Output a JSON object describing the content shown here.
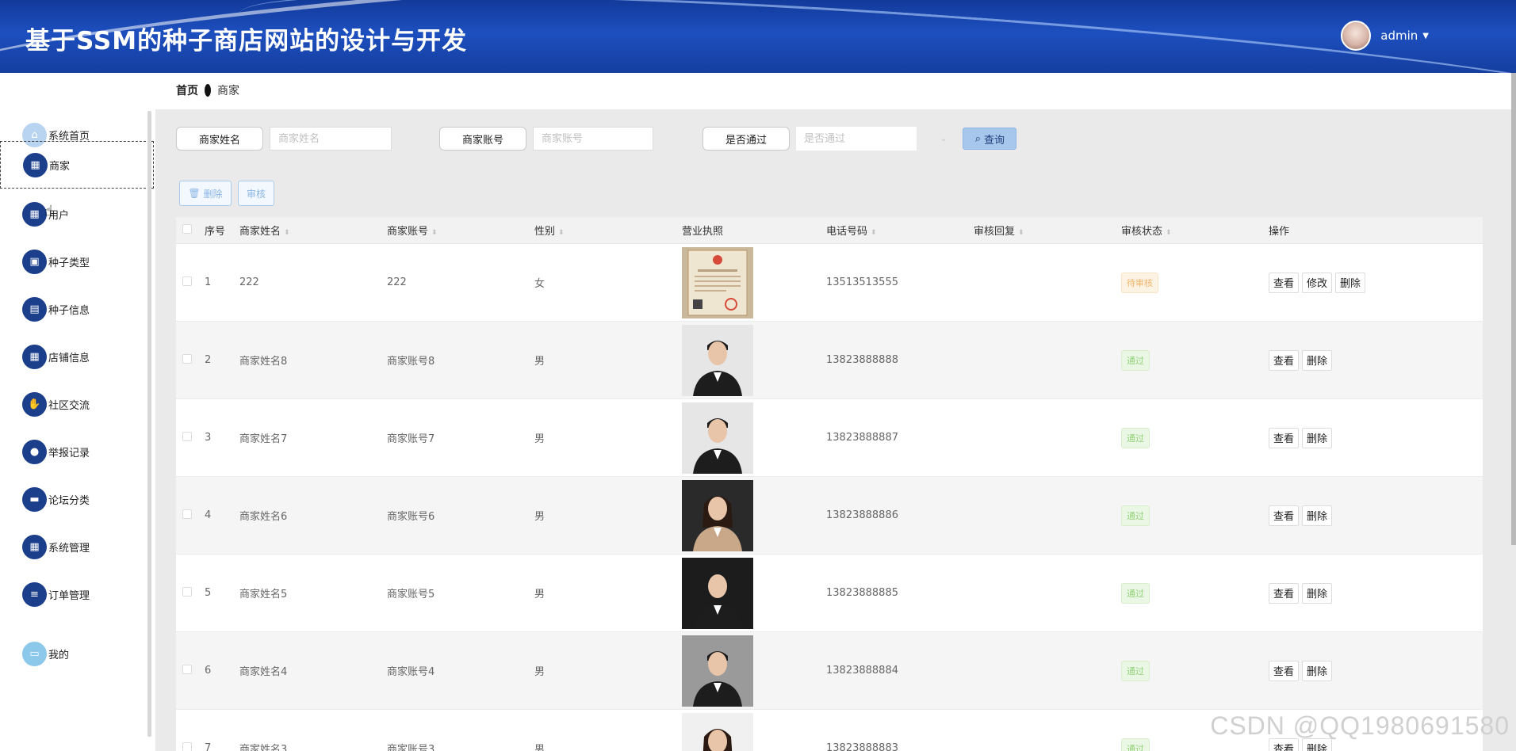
{
  "header": {
    "title": "基于SSM的种子商店网站的设计与开发",
    "username": "admin"
  },
  "breadcrumb": {
    "home": "首页",
    "current": "商家"
  },
  "sidebar": {
    "items": [
      {
        "label": "系统首页",
        "icon": "home-icon"
      },
      {
        "label": "商家",
        "icon": "grid-icon"
      },
      {
        "label": "用户",
        "icon": "grid-icon"
      },
      {
        "label": "种子类型",
        "icon": "briefcase-icon"
      },
      {
        "label": "种子信息",
        "icon": "clipboard-icon"
      },
      {
        "label": "店铺信息",
        "icon": "grid-icon"
      },
      {
        "label": "社区交流",
        "icon": "thumbs-up-icon"
      },
      {
        "label": "举报记录",
        "icon": "bulb-icon"
      },
      {
        "label": "论坛分类",
        "icon": "ticket-icon"
      },
      {
        "label": "系统管理",
        "icon": "grid-icon"
      },
      {
        "label": "订单管理",
        "icon": "list-icon"
      },
      {
        "label": "我的",
        "icon": "card-icon"
      }
    ]
  },
  "search": {
    "name_label": "商家姓名",
    "name_placeholder": "商家姓名",
    "account_label": "商家账号",
    "account_placeholder": "商家账号",
    "pass_label": "是否通过",
    "pass_placeholder": "是否通过",
    "query_label": "查询"
  },
  "actions": {
    "delete_label": "删除",
    "audit_label": "审核"
  },
  "table": {
    "headers": {
      "no": "序号",
      "name": "商家姓名",
      "account": "商家账号",
      "sex": "性别",
      "license": "营业执照",
      "phone": "电话号码",
      "reply": "审核回复",
      "status": "审核状态",
      "ops": "操作"
    },
    "rows": [
      {
        "no": "1",
        "name": "222",
        "account": "222",
        "sex": "女",
        "phone": "13513513555",
        "reply": "",
        "status": "待审核",
        "status_type": "pending",
        "ops": [
          "查看",
          "修改",
          "删除"
        ],
        "photo": "license"
      },
      {
        "no": "2",
        "name": "商家姓名8",
        "account": "商家账号8",
        "sex": "男",
        "phone": "13823888888",
        "reply": "",
        "status": "通过",
        "status_type": "pass",
        "ops": [
          "查看",
          "删除"
        ],
        "photo": "man-light"
      },
      {
        "no": "3",
        "name": "商家姓名7",
        "account": "商家账号7",
        "sex": "男",
        "phone": "13823888887",
        "reply": "",
        "status": "通过",
        "status_type": "pass",
        "ops": [
          "查看",
          "删除"
        ],
        "photo": "man-light"
      },
      {
        "no": "4",
        "name": "商家姓名6",
        "account": "商家账号6",
        "sex": "男",
        "phone": "13823888886",
        "reply": "",
        "status": "通过",
        "status_type": "pass",
        "ops": [
          "查看",
          "删除"
        ],
        "photo": "woman-dark"
      },
      {
        "no": "5",
        "name": "商家姓名5",
        "account": "商家账号5",
        "sex": "男",
        "phone": "13823888885",
        "reply": "",
        "status": "通过",
        "status_type": "pass",
        "ops": [
          "查看",
          "删除"
        ],
        "photo": "man-dark"
      },
      {
        "no": "6",
        "name": "商家姓名4",
        "account": "商家账号4",
        "sex": "男",
        "phone": "13823888884",
        "reply": "",
        "status": "通过",
        "status_type": "pass",
        "ops": [
          "查看",
          "删除"
        ],
        "photo": "man-grey"
      },
      {
        "no": "7",
        "name": "商家姓名3",
        "account": "商家账号3",
        "sex": "男",
        "phone": "13823888883",
        "reply": "",
        "status": "通过",
        "status_type": "pass",
        "ops": [
          "查看",
          "删除"
        ],
        "photo": "woman-light"
      }
    ]
  },
  "watermark": "CSDN @QQ1980691580"
}
